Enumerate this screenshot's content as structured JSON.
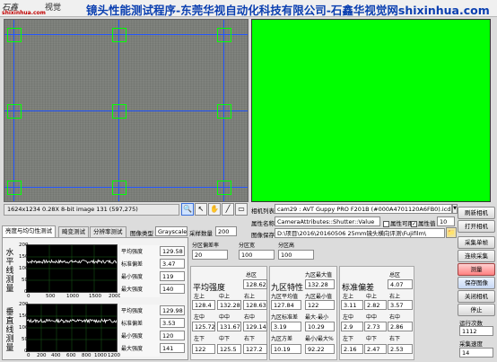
{
  "header": {
    "logo_line1": "石鑫",
    "logo_line2": "视觉",
    "logo_line3": "shixinhua.com",
    "title": "镜头性能测试程序-东莞华视自动化科技有限公司-石鑫华视觉网shixinhua.com"
  },
  "viewer": {
    "status_text": "1624x1234 0.28X 8-bit image 131    (597,275)",
    "tools": [
      "zoom-icon",
      "pointer-icon",
      "pan-icon",
      "line-icon",
      "rect-icon"
    ]
  },
  "camera": {
    "list_label": "相机列表",
    "list_value": "cam29 : AVT Guppy PRO F201B (#000A4701120A6FB0).icd",
    "attr_label": "属性名称",
    "attr_value": "CameraAttributes::Shutter::Value",
    "attr_enable_label": "属性可用",
    "attr_value_label": "属性值",
    "attr_value_num": "10",
    "save_label": "图像保存",
    "save_path": "D:\\项目\\2016\\20160506 25mm镜头横向评测\\Fujifilm\\"
  },
  "side_buttons": {
    "refresh": "刷新相机",
    "open": "打开相机",
    "single": "采集单帧",
    "continuous": "连续采集",
    "measure": "测量",
    "save_image": "保存图像",
    "close": "关闭相机",
    "stop": "停止",
    "run_count_label": "运行次数",
    "run_count": "1112",
    "speed_label": "采集速度",
    "speed": "14"
  },
  "tabs": {
    "items": [
      "亮度与均匀性测试",
      "畸变测试",
      "分辨率测试"
    ],
    "image_type_label": "图像类型",
    "image_type_value": "Grayscale",
    "sample_count_label": "采样数量",
    "sample_count": "200"
  },
  "plots": {
    "h_label": "水平线测量",
    "v_label": "垂直线测量",
    "h_stats": {
      "avg_label": "平均强度",
      "avg": "129.58",
      "std_label": "标准偏差",
      "std": "3.47",
      "min_label": "最小强度",
      "min": "119",
      "max_label": "最大强度",
      "max": "140"
    },
    "v_stats": {
      "avg_label": "平均强度",
      "avg": "129.98",
      "std_label": "标准偏差",
      "std": "3.53",
      "min_label": "最小强度",
      "min": "120",
      "max_label": "最大强度",
      "max": "141"
    },
    "y_ticks": [
      "200",
      "150",
      "100",
      "50",
      "0"
    ],
    "x_ticks": [
      "0",
      "500",
      "1000",
      "1500",
      "2000"
    ],
    "x_ticks_v": [
      "0",
      "200",
      "400",
      "600",
      "800",
      "1000",
      "1200"
    ]
  },
  "partition": {
    "tolerance_label": "分区偏差率",
    "tolerance": "20",
    "width_label": "分区宽",
    "width": "100",
    "height_label": "分区高",
    "height": "100"
  },
  "avg_intensity": {
    "title": "平均强度",
    "total_label": "总区",
    "total": "128.62",
    "tl_label": "左上",
    "tc_label": "中上",
    "tr_label": "右上",
    "tl": "128.4",
    "tc": "132.28",
    "tr": "128.63",
    "ml_label": "左中",
    "mc_label": "中中",
    "mr_label": "右中",
    "ml": "125.72",
    "mc": "131.67",
    "mr": "129.14",
    "bl_label": "左下",
    "bc_label": "中下",
    "br_label": "右下",
    "bl": "122",
    "bc": "125.5",
    "br": "127.2"
  },
  "nine_zone": {
    "title": "九区特性",
    "max_label": "九区最大值",
    "max": "132.28",
    "avg_label": "九区平均值",
    "avg": "127.84",
    "min_label": "九区最小值",
    "min": "122",
    "std_label": "九区标准差",
    "std": "3.19",
    "diff_label": "最大-最小",
    "diff": "10.29",
    "var_label": "九区方差",
    "var": "10.19",
    "pct_label": "最小/最大%",
    "pct": "92.22"
  },
  "std_dev": {
    "title": "标准偏差",
    "total_label": "总区",
    "total": "4.07",
    "tl_label": "左上",
    "tc_label": "中上",
    "tr_label": "右上",
    "tl": "3.11",
    "tc": "2.82",
    "tr": "3.57",
    "ml_label": "左中",
    "mc_label": "中中",
    "mr_label": "右中",
    "ml": "2.9",
    "mc": "2.73",
    "mr": "2.86",
    "bl_label": "左下",
    "bc_label": "中下",
    "br_label": "右下",
    "bl": "2.16",
    "bc": "2.47",
    "br": "2.53"
  },
  "colors": {
    "title": "#0a3fb0",
    "green": "#00ff00",
    "crosshair": "#2255ff",
    "plot_line": "#ffffff"
  }
}
